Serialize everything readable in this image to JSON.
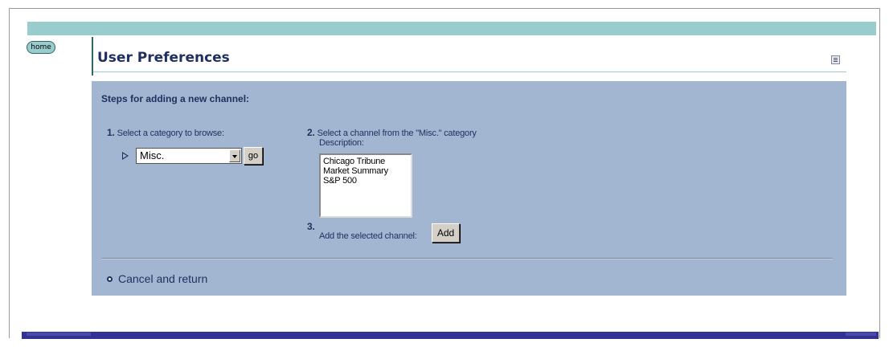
{
  "header": {
    "home_label": "home",
    "title": "User Preferences",
    "print_icon": "print-icon"
  },
  "steps": {
    "title": "Steps for adding a new channel:",
    "step1": {
      "number": "1.",
      "text": "Select a category to browse:"
    },
    "category_select": {
      "selected": "Misc."
    },
    "go_label": "go",
    "step2": {
      "number": "2.",
      "text": "Select a channel from the \"Misc.\" category",
      "subtext": "Description:"
    },
    "channels": [
      "Chicago Tribune",
      "Market Summary",
      "S&P 500"
    ],
    "step3": {
      "number": "3.",
      "text": "Add the selected channel:"
    },
    "add_label": "Add"
  },
  "footer": {
    "cancel_label": "Cancel and return"
  },
  "colors": {
    "accent_teal": "#99cccc",
    "panel_blue": "#a3b6d1",
    "text_navy": "#1f2f5f",
    "bottom_bar": "#323296"
  }
}
